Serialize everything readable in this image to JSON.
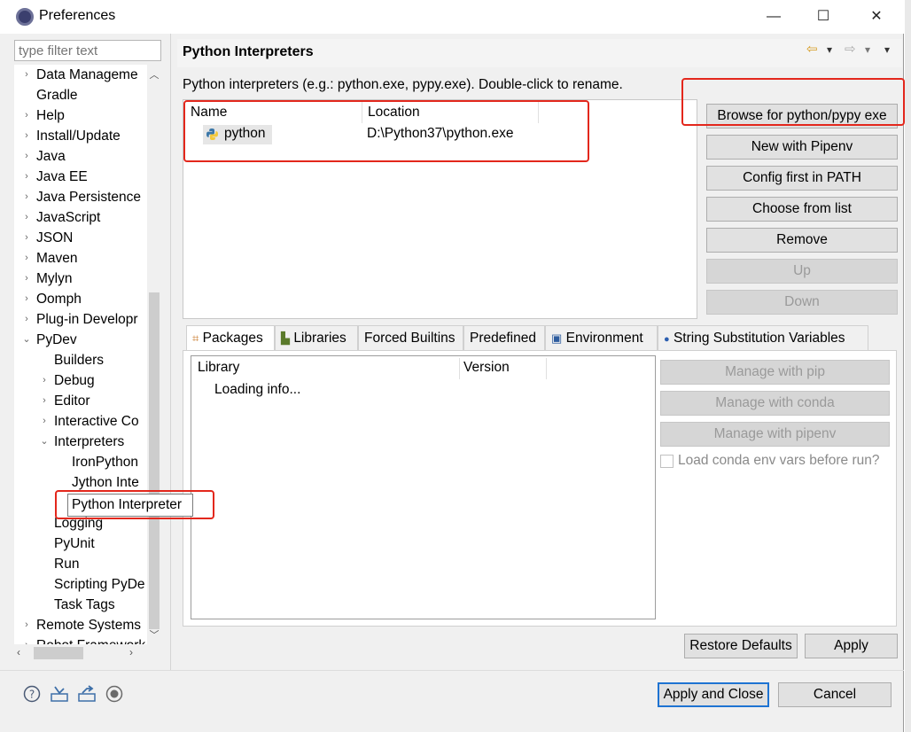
{
  "window": {
    "title": "Preferences",
    "min_label": "—",
    "max_label": "☐",
    "close_label": "✕"
  },
  "filter": {
    "placeholder": "type filter text"
  },
  "tree": {
    "items": [
      {
        "label": "Data Manageme",
        "expander": "›",
        "level": 0
      },
      {
        "label": "Gradle",
        "expander": "",
        "level": 0
      },
      {
        "label": "Help",
        "expander": "›",
        "level": 0
      },
      {
        "label": "Install/Update",
        "expander": "›",
        "level": 0
      },
      {
        "label": "Java",
        "expander": "›",
        "level": 0
      },
      {
        "label": "Java EE",
        "expander": "›",
        "level": 0
      },
      {
        "label": "Java Persistence",
        "expander": "›",
        "level": 0
      },
      {
        "label": "JavaScript",
        "expander": "›",
        "level": 0
      },
      {
        "label": "JSON",
        "expander": "›",
        "level": 0
      },
      {
        "label": "Maven",
        "expander": "›",
        "level": 0
      },
      {
        "label": "Mylyn",
        "expander": "›",
        "level": 0
      },
      {
        "label": "Oomph",
        "expander": "›",
        "level": 0
      },
      {
        "label": "Plug-in Developr",
        "expander": "›",
        "level": 0
      },
      {
        "label": "PyDev",
        "expander": "⌄",
        "level": 0
      },
      {
        "label": "Builders",
        "expander": "",
        "level": 1
      },
      {
        "label": "Debug",
        "expander": "›",
        "level": 1
      },
      {
        "label": "Editor",
        "expander": "›",
        "level": 1
      },
      {
        "label": "Interactive Co",
        "expander": "›",
        "level": 1
      },
      {
        "label": "Interpreters",
        "expander": "⌄",
        "level": 1
      },
      {
        "label": "IronPython",
        "expander": "",
        "level": 2
      },
      {
        "label": "Jython Inte",
        "expander": "",
        "level": 2
      },
      {
        "label": "Python Interpreter",
        "expander": "",
        "level": 2
      },
      {
        "label": "Logging",
        "expander": "",
        "level": 1
      },
      {
        "label": "PyUnit",
        "expander": "",
        "level": 1
      },
      {
        "label": "Run",
        "expander": "",
        "level": 1
      },
      {
        "label": "Scripting PyDe",
        "expander": "",
        "level": 1
      },
      {
        "label": "Task Tags",
        "expander": "",
        "level": 1
      },
      {
        "label": "Remote Systems",
        "expander": "›",
        "level": 0
      },
      {
        "label": "Robot Framework",
        "expander": "›",
        "level": 0
      }
    ]
  },
  "tooltip": {
    "label": "Python Interpreter"
  },
  "page": {
    "title": "Python Interpreters",
    "description": "Python interpreters (e.g.: python.exe, pypy.exe).   Double-click to rename.",
    "nav_back": "⇦",
    "nav_forward": "⇨",
    "nav_menu": "▾"
  },
  "interpreters": {
    "col_name": "Name",
    "col_location": "Location",
    "rows": [
      {
        "name": "python",
        "location": "D:\\Python37\\python.exe"
      }
    ]
  },
  "side_buttons": {
    "browse": "Browse for python/pypy exe",
    "pipenv": "New with Pipenv",
    "config_path": "Config first in PATH",
    "choose": "Choose from list",
    "remove": "Remove",
    "up": "Up",
    "down": "Down"
  },
  "tabs": [
    {
      "label": "Packages",
      "icon": "packages-icon"
    },
    {
      "label": "Libraries",
      "icon": "libraries-icon"
    },
    {
      "label": "Forced Builtins",
      "icon": ""
    },
    {
      "label": "Predefined",
      "icon": ""
    },
    {
      "label": "Environment",
      "icon": "environment-icon"
    },
    {
      "label": "String Substitution Variables",
      "icon": "variables-icon"
    }
  ],
  "packages": {
    "col_library": "Library",
    "col_version": "Version",
    "status": "Loading info..."
  },
  "package_buttons": {
    "pip": "Manage with pip",
    "conda": "Manage with conda",
    "pipenv": "Manage with pipenv",
    "conda_check": "Load conda env vars before run?"
  },
  "footer": {
    "restore": "Restore Defaults",
    "apply": "Apply",
    "apply_close": "Apply and Close",
    "cancel": "Cancel"
  },
  "colors": {
    "highlight_box": "#e3271c",
    "default_button_border": "#1e73d2"
  }
}
